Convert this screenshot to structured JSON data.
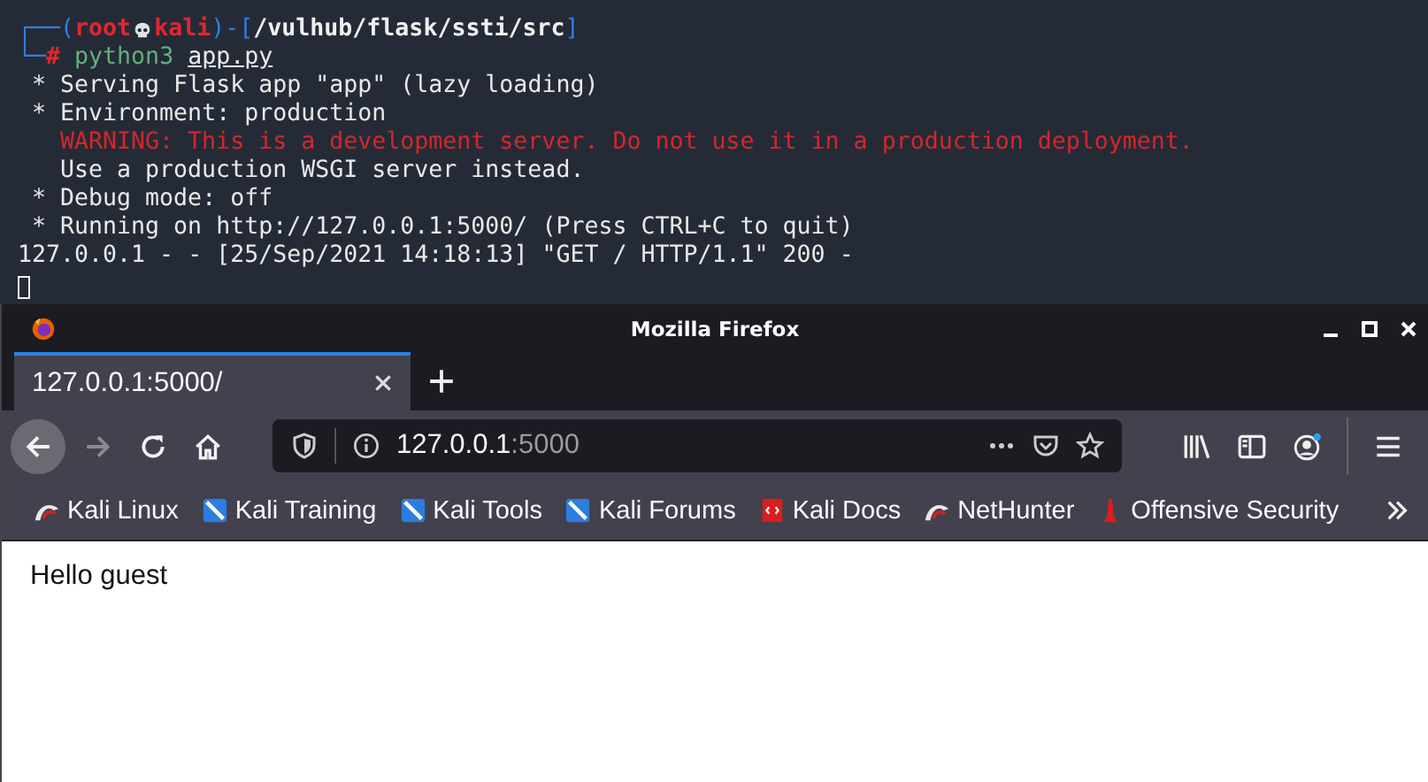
{
  "terminal": {
    "prompt": {
      "frame_top": "┌──(",
      "user": "root",
      "host": "kali",
      "frame_mid": ")-[",
      "path": "/vulhub/flask/ssti/src",
      "frame_end": "]",
      "frame_bottom": "└─",
      "symbol": "#",
      "command": "python3",
      "argument": "app.py"
    },
    "output": [
      {
        "kind": "bullet",
        "text": "* Serving Flask app \"app\" (lazy loading)"
      },
      {
        "kind": "bullet",
        "text": "* Environment: production"
      },
      {
        "kind": "warning",
        "text": "WARNING: This is a development server. Do not use it in a production deployment."
      },
      {
        "kind": "note",
        "text": "Use a production WSGI server instead."
      },
      {
        "kind": "bullet",
        "text": "* Debug mode: off"
      },
      {
        "kind": "bullet",
        "text": "* Running on http://127.0.0.1:5000/ (Press CTRL+C to quit)"
      },
      {
        "kind": "log",
        "text": "127.0.0.1 - - [25/Sep/2021 14:18:13] \"GET / HTTP/1.1\" 200 -"
      }
    ]
  },
  "browser": {
    "window": {
      "title": "Mozilla Firefox"
    },
    "tabs": [
      {
        "title": "127.0.0.1:5000/",
        "selected": true
      }
    ],
    "address_bar": {
      "host": "127.0.0.1",
      "port": ":5000"
    },
    "bookmarks": [
      {
        "kind": "dragon",
        "label": "Kali Linux"
      },
      {
        "kind": "kali",
        "label": "Kali Training"
      },
      {
        "kind": "kali",
        "label": "Kali Tools"
      },
      {
        "kind": "kali",
        "label": "Kali Forums"
      },
      {
        "kind": "docs",
        "label": "Kali Docs"
      },
      {
        "kind": "dragon",
        "label": "NetHunter"
      },
      {
        "kind": "offsec",
        "label": "Offensive Security"
      }
    ],
    "page": {
      "text": "Hello guest"
    }
  }
}
